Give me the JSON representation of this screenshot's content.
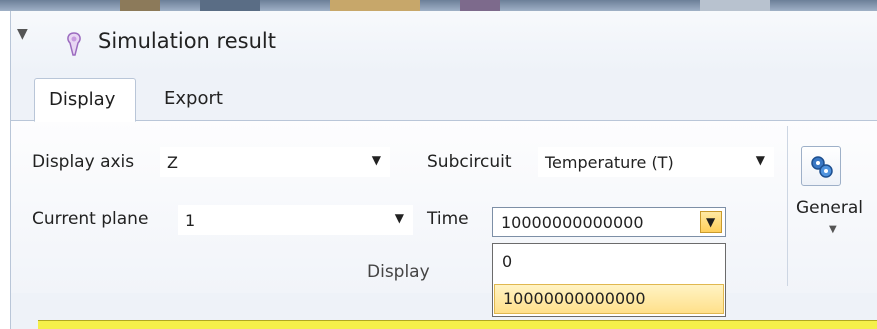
{
  "panel": {
    "title": "Simulation result"
  },
  "tabs": [
    {
      "label": "Display",
      "active": true
    },
    {
      "label": "Export",
      "active": false
    }
  ],
  "display_group": {
    "display_axis": {
      "label": "Display axis",
      "value": "Z"
    },
    "current_plane": {
      "label": "Current plane",
      "value": "1"
    },
    "subcircuit": {
      "label": "Subcircuit",
      "value": "Temperature (T)"
    },
    "time": {
      "label": "Time",
      "value": "10000000000000",
      "options": [
        "0",
        "10000000000000"
      ]
    },
    "group_label": "Display"
  },
  "general_group": {
    "label": "General"
  },
  "colors": {
    "accent_orange": "#ffcf5a",
    "selection": "#ffe08a",
    "ribbon_border": "#b9c6d8"
  }
}
